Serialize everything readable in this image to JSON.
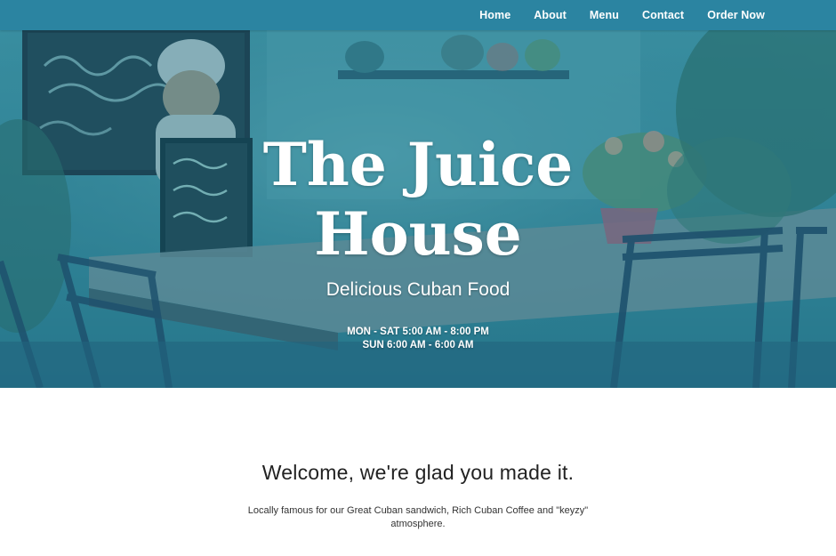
{
  "nav": {
    "items": [
      {
        "label": "Home"
      },
      {
        "label": "About"
      },
      {
        "label": "Menu"
      },
      {
        "label": "Contact"
      },
      {
        "label": "Order Now"
      }
    ]
  },
  "hero": {
    "title_line1": "The Juice",
    "title_line2": "House",
    "subtitle": "Delicious Cuban Food",
    "hours_line1": "MON - SAT 5:00 AM - 8:00 PM",
    "hours_line2": "SUN 6:00 AM - 6:00 AM"
  },
  "welcome": {
    "heading": "Welcome, we're glad you made it.",
    "text": "Locally famous for our Great Cuban sandwich, Rich Cuban Coffee and \"keyzy\" atmosphere."
  },
  "colors": {
    "nav_bg": "#2b84a1",
    "hero_overlay": "#1f6e96",
    "text_dark": "#222222"
  }
}
